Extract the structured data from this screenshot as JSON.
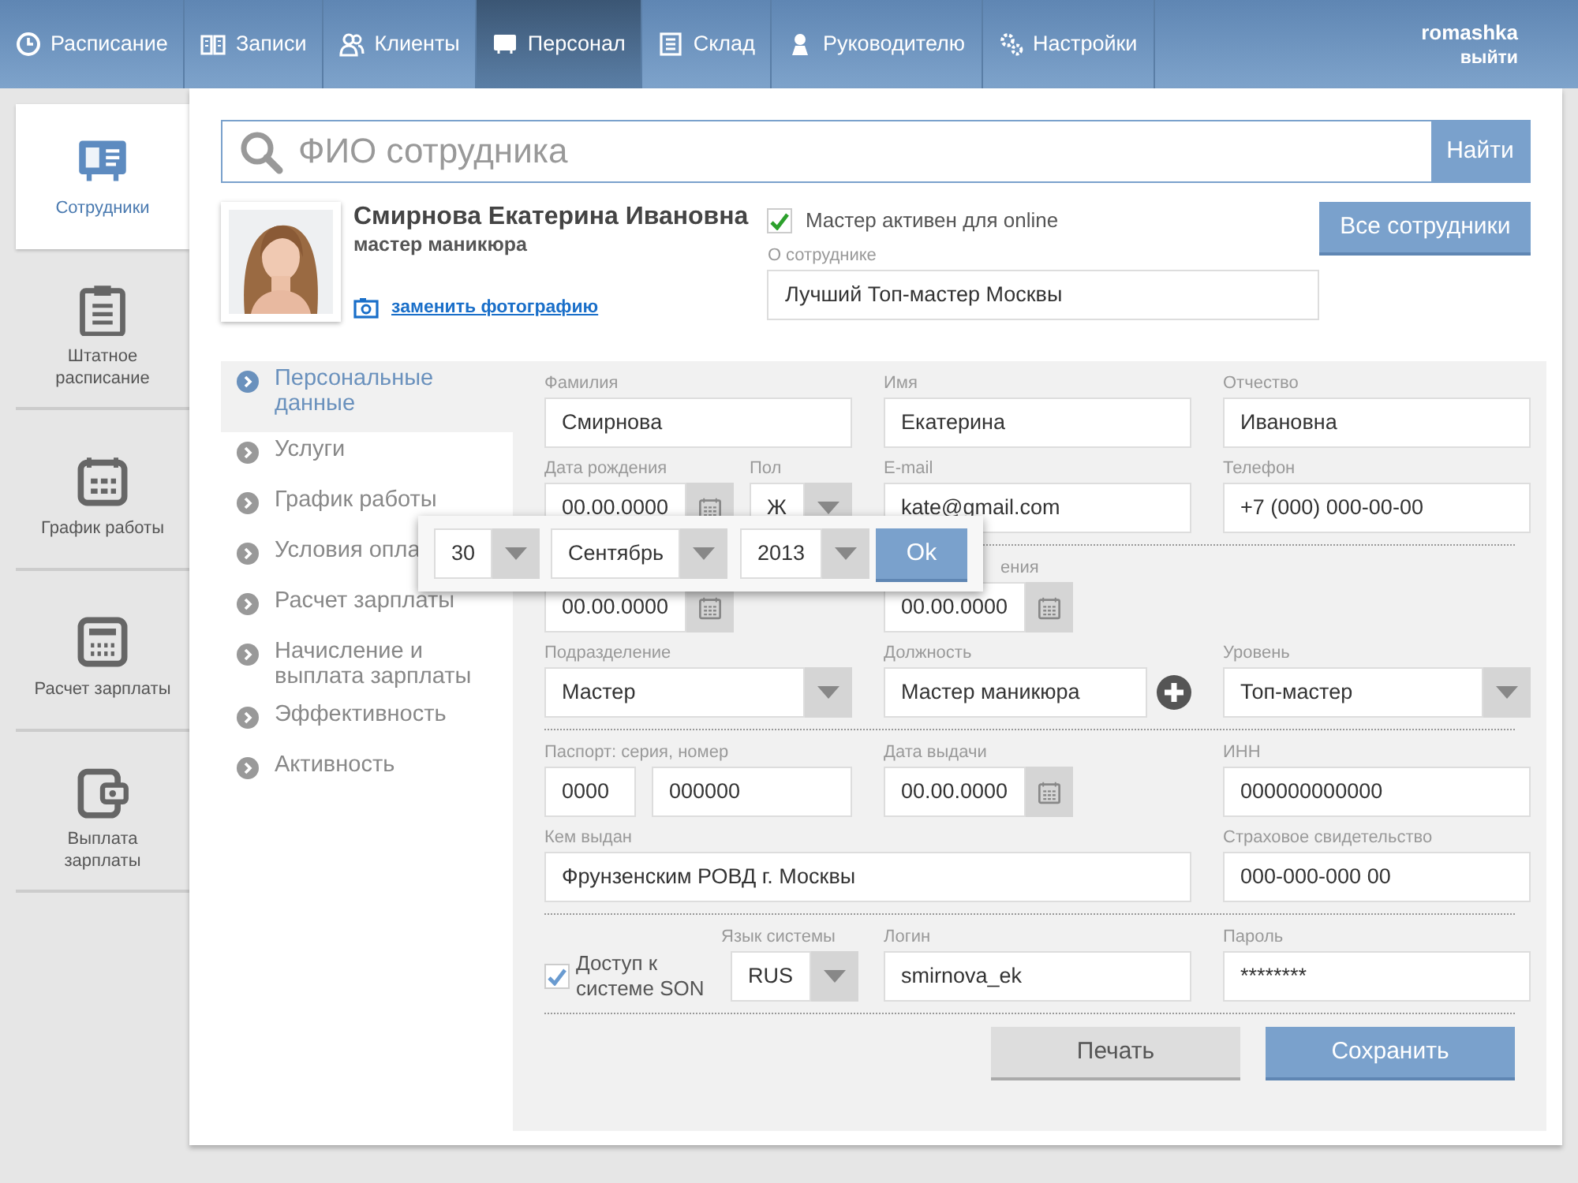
{
  "nav": {
    "items": [
      {
        "label": "Расписание",
        "selected": false
      },
      {
        "label": "Записи",
        "selected": false
      },
      {
        "label": "Клиенты",
        "selected": false
      },
      {
        "label": "Персонал",
        "selected": true
      },
      {
        "label": "Склад",
        "selected": false
      },
      {
        "label": "Руководителю",
        "selected": false
      },
      {
        "label": "Настройки",
        "selected": false
      }
    ],
    "user": {
      "name": "romashka",
      "logout": "выйти"
    }
  },
  "rail": [
    {
      "label": "Сотрудники",
      "selected": true
    },
    {
      "label": "Штатное расписание",
      "selected": false
    },
    {
      "label": "График работы",
      "selected": false
    },
    {
      "label": "Расчет зарплаты",
      "selected": false
    },
    {
      "label": "Выплата зарплаты",
      "selected": false
    }
  ],
  "search": {
    "placeholder": "ФИО сотрудника",
    "button": "Найти"
  },
  "profile": {
    "name": "Смирнова Екатерина Ивановна",
    "position": "мастер маникюра",
    "change_photo": "заменить фотографию",
    "online": {
      "label": "Мастер активен для online",
      "checked": true
    },
    "all_button": "Все сотрудники",
    "about": {
      "label": "О сотруднике",
      "value": "Лучший Топ-мастер Москвы"
    }
  },
  "menu": [
    {
      "label": "Персональные данные",
      "selected": true
    },
    {
      "label": "Услуги",
      "selected": false
    },
    {
      "label": "График работы",
      "selected": false
    },
    {
      "label": "Условия опла",
      "selected": false
    },
    {
      "label": "Расчет зарплаты",
      "selected": false
    },
    {
      "label": "Начисление и выплата зарплаты",
      "selected": false
    },
    {
      "label": "Эффективность",
      "selected": false
    },
    {
      "label": "Активность",
      "selected": false
    }
  ],
  "form": [
    {
      "kind": "fields",
      "cells": [
        {
          "label": "Фамилия",
          "items": [
            {
              "kind": "text",
              "value": "Смирнова"
            }
          ]
        },
        {
          "label": "Имя",
          "items": [
            {
              "kind": "text",
              "value": "Екатерина"
            }
          ]
        },
        {
          "label": "Отчество",
          "items": [
            {
              "kind": "text",
              "value": "Ивановна"
            }
          ]
        }
      ]
    },
    {
      "kind": "fields",
      "cells": [
        {
          "label": "Дата рождения",
          "second_label": "Пол",
          "items": [
            {
              "kind": "date",
              "value": "00.00.0000"
            },
            {
              "kind": "select",
              "value": "Ж"
            }
          ]
        },
        {
          "label": "E-mail",
          "items": [
            {
              "kind": "text",
              "value": "kate@gmail.com"
            }
          ]
        },
        {
          "label": "Телефон",
          "items": [
            {
              "kind": "text",
              "value": "+7 (000) 000-00-00"
            }
          ]
        }
      ]
    },
    {
      "kind": "divider"
    },
    {
      "kind": "fields",
      "cells": [
        {
          "items": [
            {
              "kind": "date",
              "value": "00.00.0000"
            }
          ]
        },
        {
          "label": "ения",
          "label_shift": true,
          "items": [
            {
              "kind": "date",
              "value": "00.00.0000"
            }
          ]
        }
      ]
    },
    {
      "kind": "fields",
      "cells": [
        {
          "label": "Подразделение",
          "items": [
            {
              "kind": "select",
              "value": "Мастер"
            }
          ]
        },
        {
          "label": "Должность",
          "items": [
            {
              "kind": "text",
              "value": "Мастер маникюра"
            },
            {
              "kind": "plus"
            }
          ]
        },
        {
          "label": "Уровень",
          "items": [
            {
              "kind": "select",
              "value": "Топ-мастер"
            }
          ]
        }
      ]
    },
    {
      "kind": "divider"
    },
    {
      "kind": "fields",
      "cells": [
        {
          "label": "Паспорт: серия, номер",
          "items": [
            {
              "kind": "short",
              "value": "0000"
            },
            {
              "kind": "text",
              "value": "000000"
            }
          ]
        },
        {
          "label": "Дата выдачи",
          "items": [
            {
              "kind": "date",
              "value": "00.00.0000"
            }
          ]
        },
        {
          "label": "ИНН",
          "items": [
            {
              "kind": "text",
              "value": "000000000000"
            }
          ]
        }
      ]
    },
    {
      "kind": "fields",
      "cells": [
        {
          "label": "Кем выдан",
          "wide": true,
          "items": [
            {
              "kind": "text",
              "value": "Фрунзенским РОВД г. Москвы"
            }
          ]
        },
        {
          "label": "Страховое свидетельство",
          "items": [
            {
              "kind": "text",
              "value": "000-000-000 00"
            }
          ]
        }
      ]
    },
    {
      "kind": "divider"
    },
    {
      "kind": "fields",
      "cells": [
        {
          "label": "Язык системы",
          "label_shift": true,
          "items": [
            {
              "kind": "checkbox",
              "label": "Доступ к системе SON",
              "checked": true
            },
            {
              "kind": "select",
              "value": "RUS"
            }
          ]
        },
        {
          "label": "Логин",
          "items": [
            {
              "kind": "text",
              "value": "smirnova_ek"
            }
          ]
        },
        {
          "label": "Пароль",
          "items": [
            {
              "kind": "text",
              "value": "********"
            }
          ]
        }
      ]
    },
    {
      "kind": "divider"
    }
  ],
  "actions": [
    {
      "label": "Печать",
      "kind": "secondary"
    },
    {
      "label": "Сохранить",
      "kind": "primary"
    }
  ],
  "datepicker": {
    "day": "30",
    "month": "Сентябрь",
    "year": "2013",
    "button": "Ok"
  }
}
